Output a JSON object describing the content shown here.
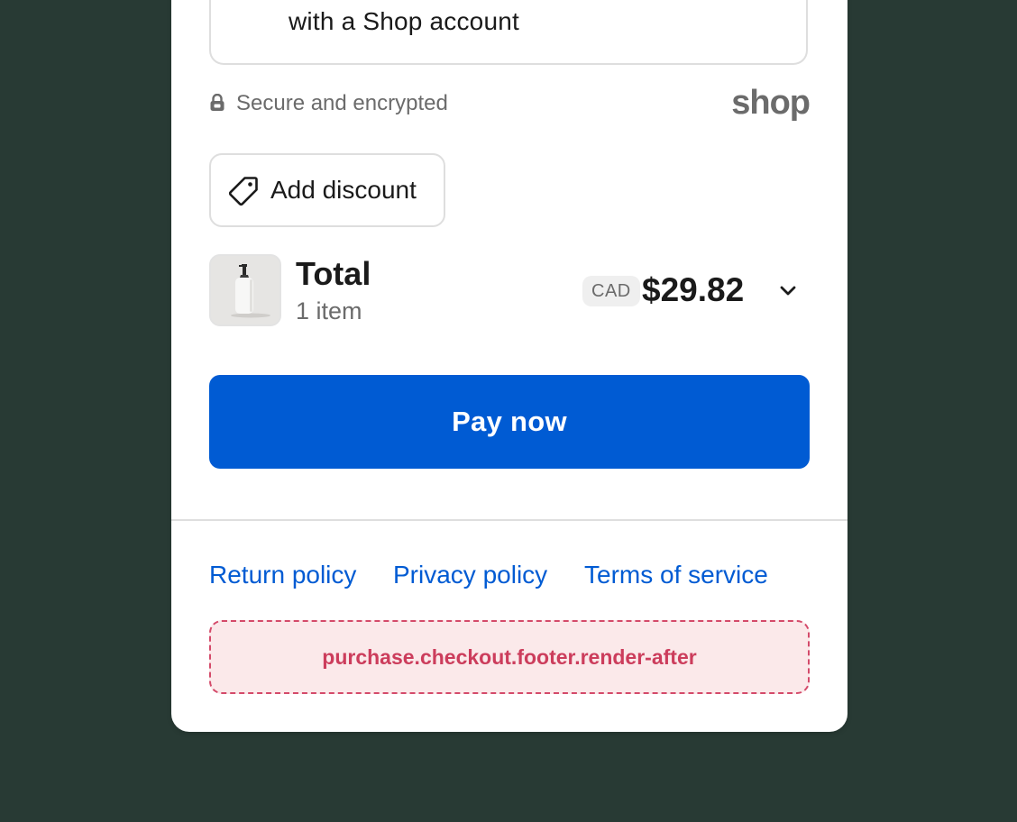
{
  "shop_pay": {
    "account_text": "with a Shop account"
  },
  "security": {
    "lock_icon": "lock-icon",
    "text": "Secure and encrypted",
    "brand_logo": "shop"
  },
  "discount": {
    "icon": "tag-icon",
    "label": "Add discount"
  },
  "total": {
    "title": "Total",
    "item_count": "1 item",
    "currency": "CAD",
    "amount": "$29.82",
    "expand_icon": "chevron-down-icon"
  },
  "pay_button": {
    "label": "Pay now",
    "color": "#005bd3"
  },
  "footer": {
    "links": [
      {
        "label": "Return policy"
      },
      {
        "label": "Privacy policy"
      },
      {
        "label": "Terms of service"
      }
    ],
    "extension_placeholder": "purchase.checkout.footer.render-after"
  },
  "colors": {
    "background": "#283a34",
    "card": "#ffffff",
    "link": "#005bd3",
    "extension_text": "#cc3d5c"
  }
}
